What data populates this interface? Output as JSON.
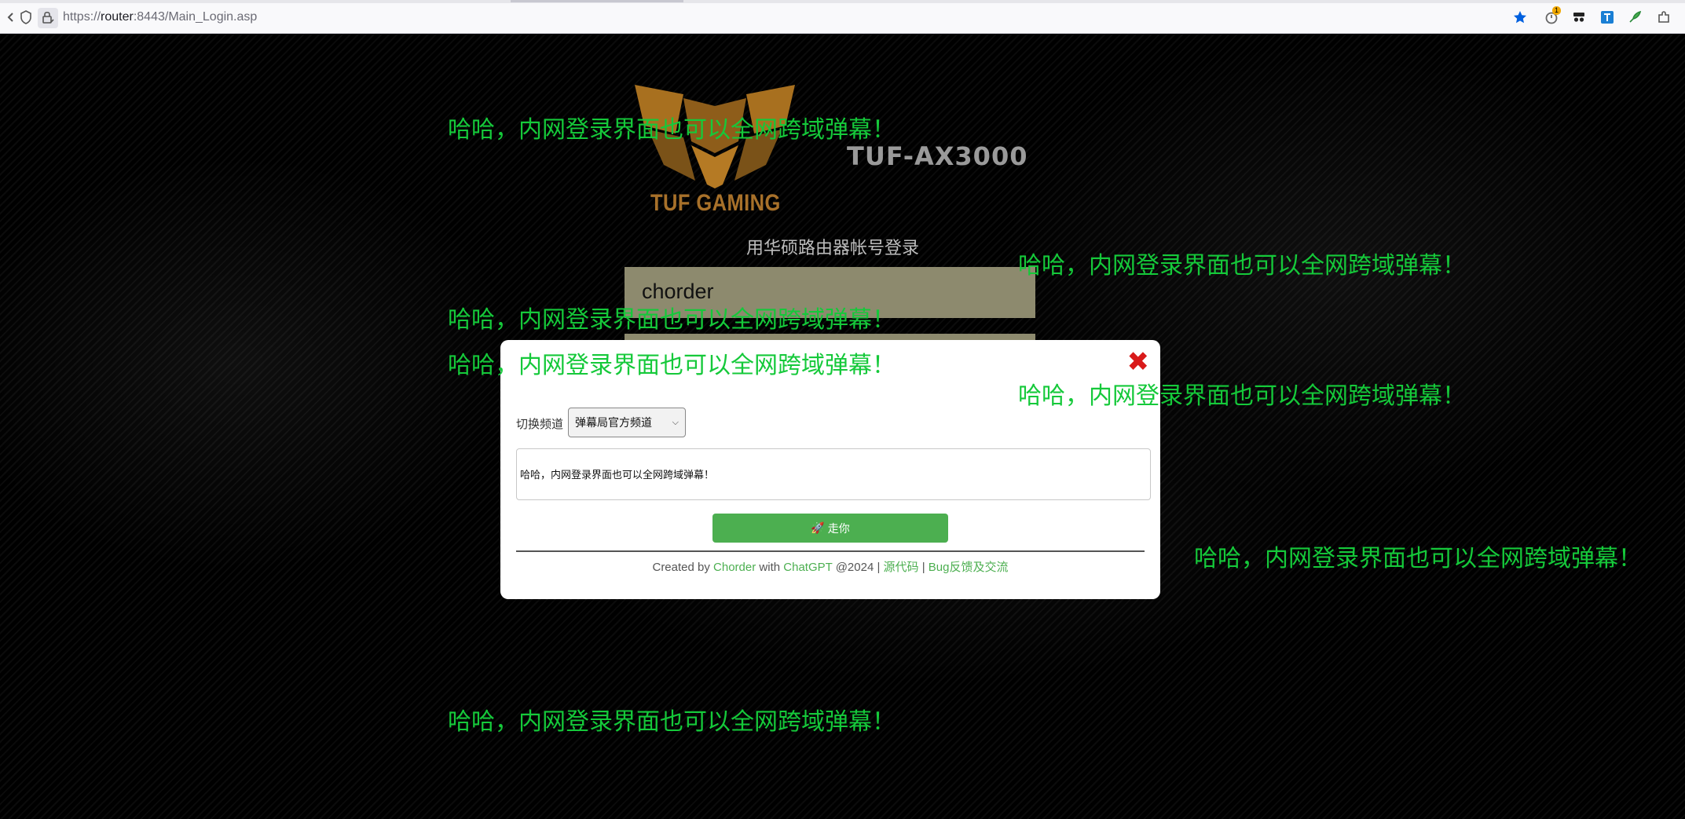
{
  "browser": {
    "url_scheme": "https://",
    "url_host": "router",
    "url_rest": ":8443/Main_Login.asp",
    "extension_badge": "1"
  },
  "login": {
    "model": "TUF-AX3000",
    "brand": "TUF GAMING",
    "title": "用华硕路由器帐号登录",
    "username_value": "chorder"
  },
  "danmaku": {
    "messages": [
      "哈哈，内网登录界面也可以全网跨域弹幕！",
      "哈哈，内网登录界面也可以全网跨域弹幕！",
      "哈哈，内网登录界面也可以全网跨域弹幕！",
      "哈哈，内网登录界面也可以全网跨域弹幕！",
      "哈哈，内网登录界面也可以全网跨域弹幕！",
      "哈哈，内网登录界面也可以全网跨域弹幕！",
      "哈哈，内网登录界面也可以全网跨域弹幕！"
    ],
    "color": "#15c93a"
  },
  "modal": {
    "close_label": "✖",
    "channel_label": "切换频道",
    "channel_selected": "弹幕局官方频道",
    "message_value": "哈哈，内网登录界面也可以全网跨域弹幕！",
    "send_label": "走你",
    "send_icon": "🚀",
    "footer": {
      "created_by": "Created by",
      "author": "Chorder",
      "with": "with",
      "tool": "ChatGPT",
      "year": "@2024 |",
      "source_link": "源代码",
      "sep": "|",
      "feedback_link": "Bug反馈及交流"
    },
    "accent_color": "#4caf50"
  }
}
